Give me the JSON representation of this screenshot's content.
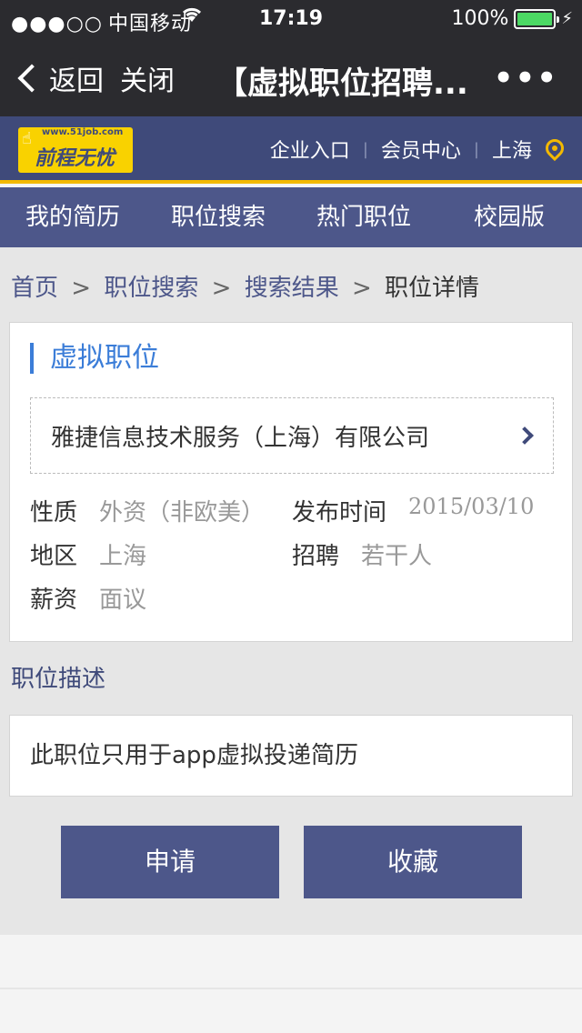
{
  "status_bar": {
    "signal": "●●●○○",
    "carrier": "中国移动",
    "wifi_icon": "wifi-icon",
    "time": "17:19",
    "battery": "100%",
    "battery_level": 1.0,
    "battery_color": "#4cd964"
  },
  "navbar": {
    "back_label": "返回",
    "close_label": "关闭",
    "title": "【虚拟职位招聘...",
    "more_label": "•••"
  },
  "header": {
    "logo_url": "www.51job.com",
    "logo_name": "前程无忧",
    "links": [
      "企业入口",
      "会员中心",
      "上海"
    ],
    "separator": "|",
    "accent": "#f3b900",
    "brand": "#3f4a7a"
  },
  "tabs": [
    "我的简历",
    "职位搜索",
    "热门职位",
    "校园版"
  ],
  "breadcrumb": {
    "items": [
      "首页",
      "职位搜索",
      "搜索结果"
    ],
    "current": "职位详情",
    "sep": ">"
  },
  "job": {
    "title": "虚拟职位",
    "company": "雅捷信息技术服务（上海）有限公司",
    "fields": {
      "nature_label": "性质",
      "nature_value": "外资（非欧美）",
      "date_label": "发布时间",
      "date_value": "2015/03/10",
      "region_label": "地区",
      "region_value": "上海",
      "hire_label": "招聘",
      "hire_value": "若干人",
      "salary_label": "薪资",
      "salary_value": "面议"
    }
  },
  "description": {
    "heading": "职位描述",
    "text": "此职位只用于app虚拟投递简历"
  },
  "actions": {
    "apply": "申请",
    "favorite": "收藏"
  }
}
